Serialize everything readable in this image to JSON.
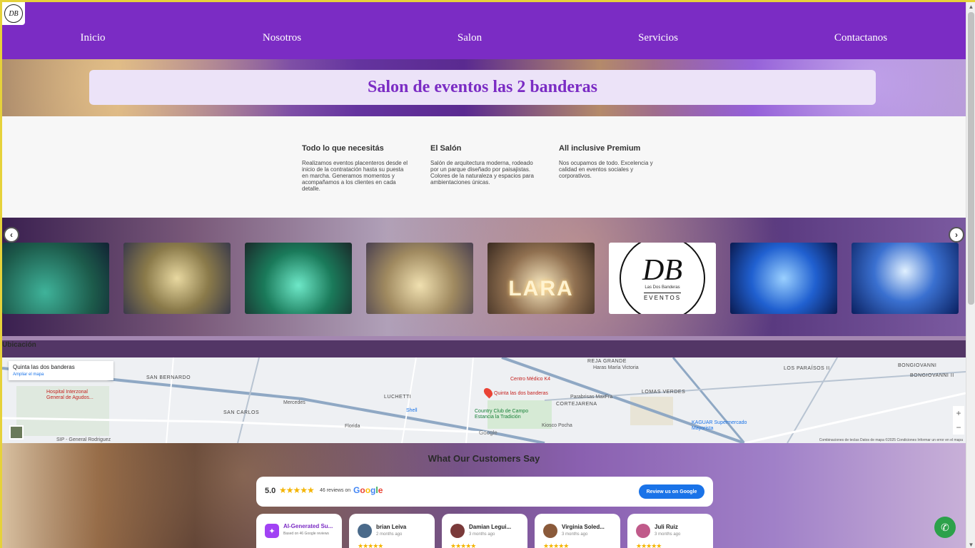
{
  "nav": {
    "links": [
      "Inicio",
      "Nosotros",
      "Salon",
      "Servicios",
      "Contactanos"
    ]
  },
  "hero": {
    "title": "Salon de eventos las 2 banderas"
  },
  "features": [
    {
      "title": "Todo lo que necesitás",
      "text": "Realizamos eventos placenteros desde el inicio de la contratación hasta su puesta en marcha. Generamos momentos y acompañamos a los clientes en cada detalle."
    },
    {
      "title": "El Salón",
      "text": "Salón de arquitectura moderna, rodeado por un parque diseñado por paisajistas. Colores de la naturaleza y espacios para ambientaciones únicas."
    },
    {
      "title": "All inclusive Premium",
      "text": "Nos ocupamos de todo. Excelencia y calidad en eventos sociales y corporativos."
    }
  ],
  "gallery": {
    "lara_text": "LARA",
    "logo_letters": "DB",
    "logo_sub": "Las Dos Banderas",
    "logo_eventos": "EVENTOS"
  },
  "location": {
    "label": "Ubicación",
    "place_name": "Quinta las dos banderas",
    "map_link": "Ampliar el mapa",
    "labels": {
      "san_bernardo": "SAN BERNARDO",
      "hospital": "Hospital Interzonal General de Agudos...",
      "san_carlos": "SAN CARLOS",
      "luchetti": "LUCHETTI",
      "shell": "Shell",
      "centro_medico": "Centro Médico K4",
      "pin_label": "Quinta las dos banderas",
      "country_club": "Country Club de Campo Estancia la Tradición",
      "reja_grande": "REJA GRANDE",
      "haras": "Haras María Victoria",
      "parabrisas": "Parabrisas MaxFra",
      "lomas_verdes": "LOMAS VERDES",
      "cortejarena": "CORTEJARENA",
      "kiosco": "Kiosco Pocha",
      "kaguar": "KAGUAR Supermercado Mayorista",
      "los_paraisos": "LOS PARAÍSOS II",
      "bongiovanni": "BONGIOVANNI",
      "bongiovanni2": "BONGIOVANNI II",
      "sip": "SIP - General Rodriguez",
      "google": "Google",
      "footer": "Combinaciones de teclas   Datos de mapa ©2025   Condiciones   Informar un error en el mapa",
      "mercedes": "Mercedes",
      "florida": "Florida"
    }
  },
  "reviews": {
    "title": "What Our Customers Say",
    "score": "5.0",
    "stars": "★★★★★",
    "count": "46 reviews on",
    "google_letters": [
      "G",
      "o",
      "o",
      "g",
      "l",
      "e"
    ],
    "button": "Review us on Google",
    "ai_card": {
      "name": "AI-Generated Su...",
      "sub": "Based on 46 Google reviews"
    },
    "cards": [
      {
        "name": "brian Leiva",
        "date": "2 months ago",
        "stars": "★★★★★",
        "color": "#4a6a8a"
      },
      {
        "name": "Damian Legui...",
        "date": "3 months ago",
        "stars": "★★★★★",
        "color": "#7a3a3a"
      },
      {
        "name": "Virginia Soled...",
        "date": "3 months ago",
        "stars": "★★★★★",
        "color": "#8a5a3a"
      },
      {
        "name": "Juli Ruiz",
        "date": "3 months ago",
        "stars": "★★★★★",
        "color": "#c05a8a"
      }
    ]
  },
  "colors": {
    "brand_purple": "#7b2cc4",
    "hero_card": "#ece3f8",
    "google_blue": "#1a73e8",
    "whatsapp_green": "#2ca14a"
  },
  "icons": {
    "prev": "chevron-left-icon",
    "next": "chevron-right-icon",
    "whatsapp": "whatsapp-icon"
  }
}
